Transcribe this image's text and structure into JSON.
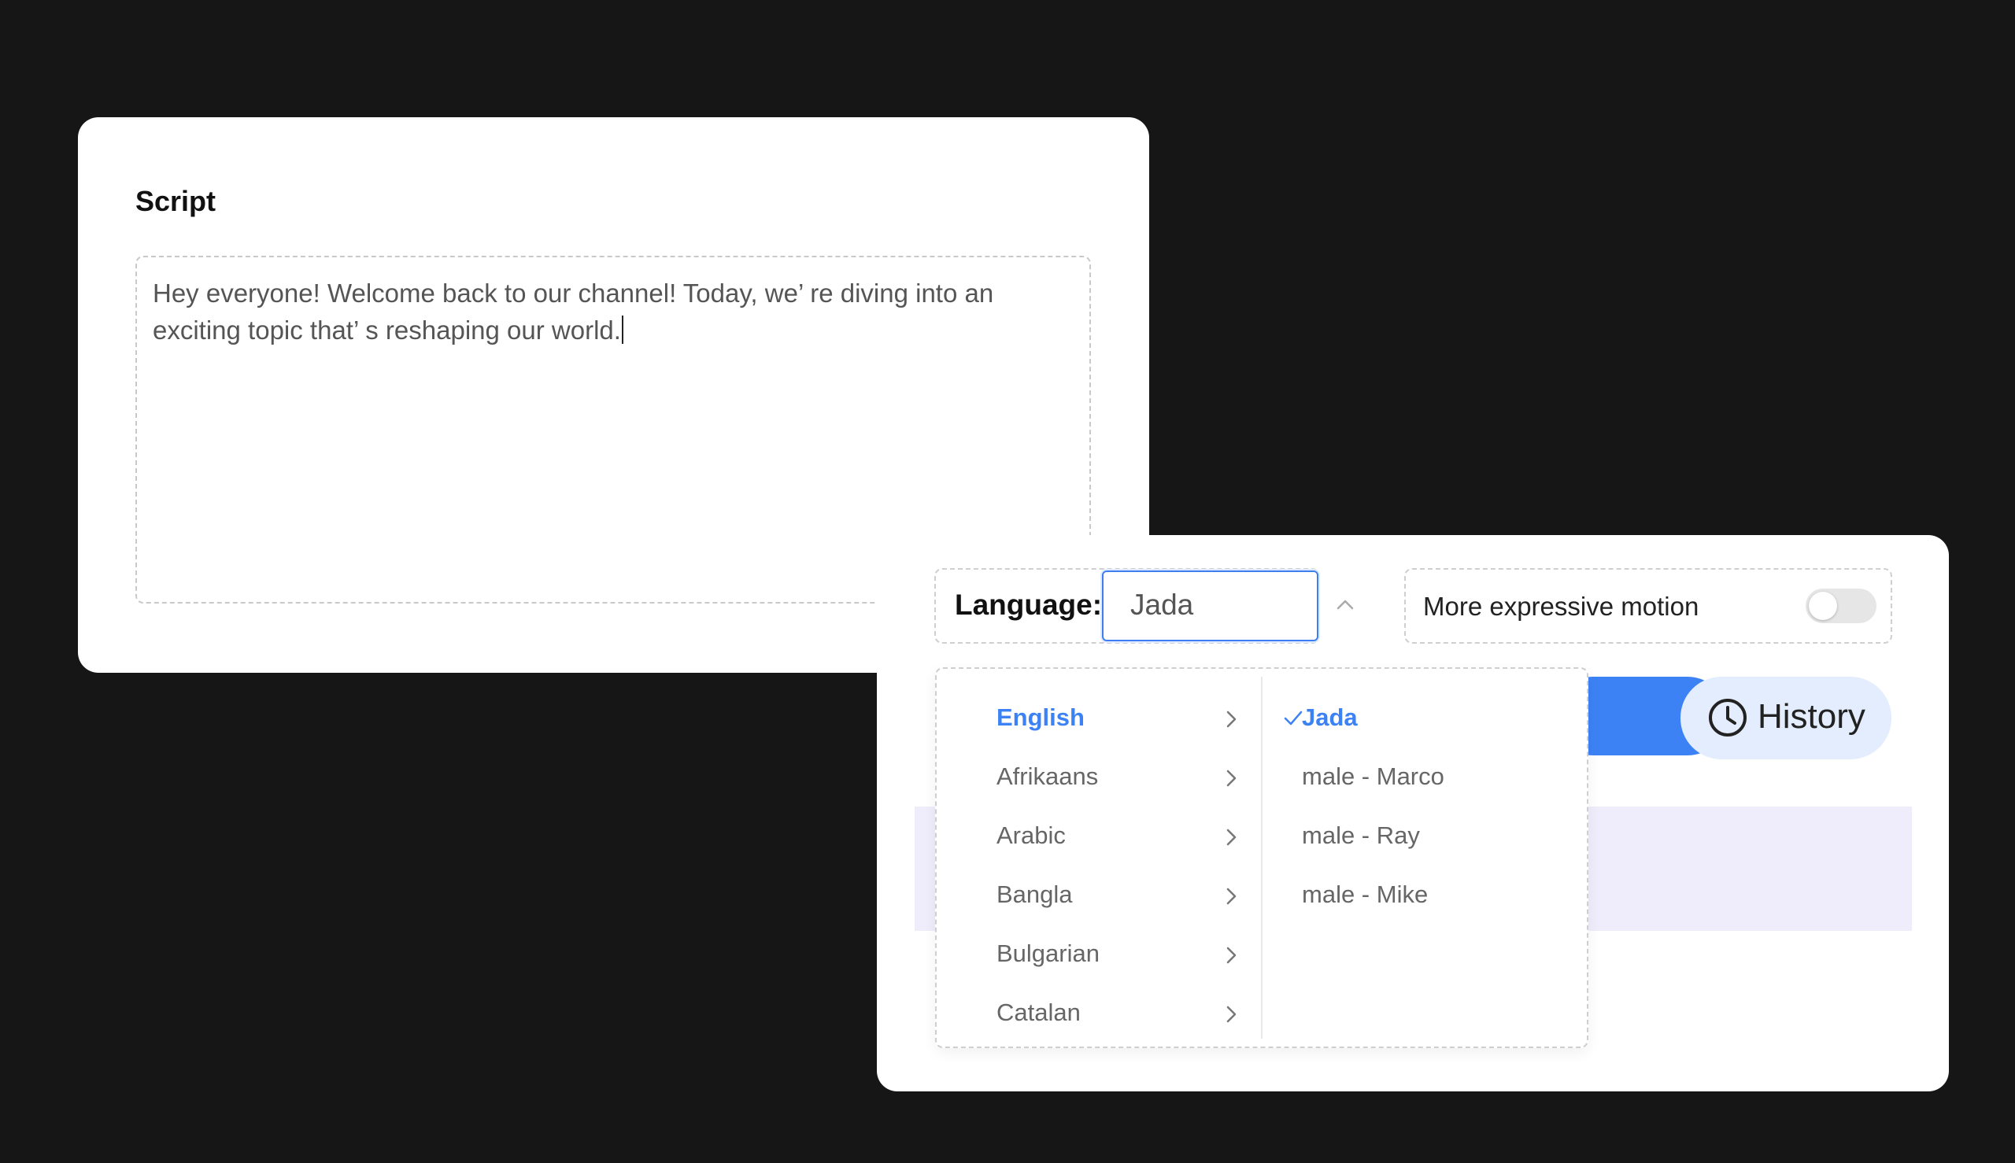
{
  "script_panel": {
    "title": "Script",
    "text": "Hey everyone! Welcome back to our channel! Today, we’  re diving into an exciting topic that’  s reshaping our world."
  },
  "voice_panel": {
    "language_label": "Language:",
    "language_value": "Jada",
    "motion_label": "More expressive motion",
    "motion_toggle_on": false,
    "history_label": "History"
  },
  "dropdown": {
    "languages": [
      {
        "label": "English",
        "active": true
      },
      {
        "label": "Afrikaans",
        "active": false
      },
      {
        "label": "Arabic",
        "active": false
      },
      {
        "label": "Bangla",
        "active": false
      },
      {
        "label": "Bulgarian",
        "active": false
      },
      {
        "label": "Catalan",
        "active": false
      }
    ],
    "voices": [
      {
        "label": "Jada",
        "selected": true
      },
      {
        "label": "male - Marco",
        "selected": false
      },
      {
        "label": "male - Ray",
        "selected": false
      },
      {
        "label": "male - Mike",
        "selected": false
      }
    ]
  },
  "colors": {
    "background": "#161616",
    "accent": "#3d82f5",
    "history_button_bg": "#e3edfd",
    "preview_strip": "#efedfb"
  },
  "icons": {
    "language_chevron": "chevron-up-icon",
    "language_item_arrow": "chevron-right-icon",
    "voice_selected": "check-icon",
    "history": "clock-icon"
  }
}
